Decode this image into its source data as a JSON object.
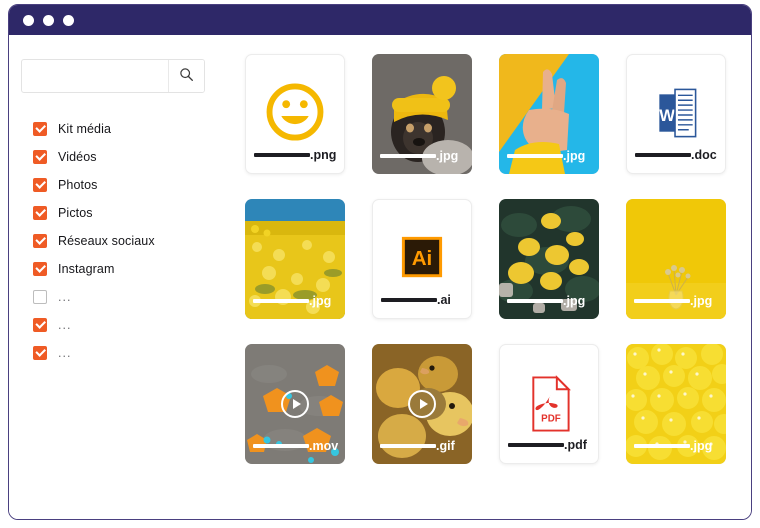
{
  "window": {
    "titlebar_color": "#2e2868",
    "dots": [
      "window-dot-1",
      "window-dot-2",
      "window-dot-3"
    ]
  },
  "sidebar": {
    "search": {
      "value": "",
      "placeholder": "",
      "icon": "search-icon",
      "button_label": ""
    },
    "filters": [
      {
        "label": "Kit média",
        "checked": true
      },
      {
        "label": "Vidéos",
        "checked": true
      },
      {
        "label": "Photos",
        "checked": true
      },
      {
        "label": "Pictos",
        "checked": true
      },
      {
        "label": "Réseaux sociaux",
        "checked": true
      },
      {
        "label": "Instagram",
        "checked": true
      },
      {
        "label": "...",
        "checked": false
      },
      {
        "label": "...",
        "checked": true
      },
      {
        "label": "...",
        "checked": true
      }
    ]
  },
  "colors": {
    "accent_orange": "#ef5b25",
    "titlebar_indigo": "#2e2868",
    "yellow": "#f5b800",
    "word_blue": "#2b579a",
    "pdf_red": "#e3322b",
    "ai_orange": "#ff9a00"
  },
  "grid": {
    "files": [
      {
        "name_redacted": true,
        "extension": ".png",
        "kind": "document",
        "thumb": "smiley-icon",
        "label_on_dark": false,
        "video": false
      },
      {
        "name_redacted": true,
        "extension": ".jpg",
        "kind": "photo",
        "thumb": "pug-in-yellow-beanie",
        "label_on_dark": true,
        "video": false
      },
      {
        "name_redacted": true,
        "extension": ".jpg",
        "kind": "photo",
        "thumb": "hand-peace-sign",
        "label_on_dark": true,
        "video": false
      },
      {
        "name_redacted": true,
        "extension": ".doc",
        "kind": "document",
        "thumb": "word-icon",
        "label_on_dark": false,
        "video": false
      },
      {
        "name_redacted": true,
        "extension": ".jpg",
        "kind": "photo",
        "thumb": "yellow-flower-field",
        "label_on_dark": true,
        "video": false
      },
      {
        "name_redacted": true,
        "extension": ".ai",
        "kind": "document",
        "thumb": "illustrator-icon",
        "label_on_dark": false,
        "video": false
      },
      {
        "name_redacted": true,
        "extension": ".jpg",
        "kind": "photo",
        "thumb": "lemons-on-tree",
        "label_on_dark": true,
        "video": false
      },
      {
        "name_redacted": true,
        "extension": ".jpg",
        "kind": "photo",
        "thumb": "vase-on-yellow",
        "label_on_dark": true,
        "video": false
      },
      {
        "name_redacted": true,
        "extension": ".mov",
        "kind": "photo",
        "thumb": "orange-shapes-street",
        "label_on_dark": true,
        "video": true
      },
      {
        "name_redacted": true,
        "extension": ".gif",
        "kind": "photo",
        "thumb": "ducklings",
        "label_on_dark": true,
        "video": true
      },
      {
        "name_redacted": true,
        "extension": ".pdf",
        "kind": "document",
        "thumb": "pdf-icon",
        "label_on_dark": false,
        "video": false
      },
      {
        "name_redacted": true,
        "extension": ".jpg",
        "kind": "photo",
        "thumb": "yellow-balls",
        "label_on_dark": true,
        "video": false
      }
    ]
  }
}
